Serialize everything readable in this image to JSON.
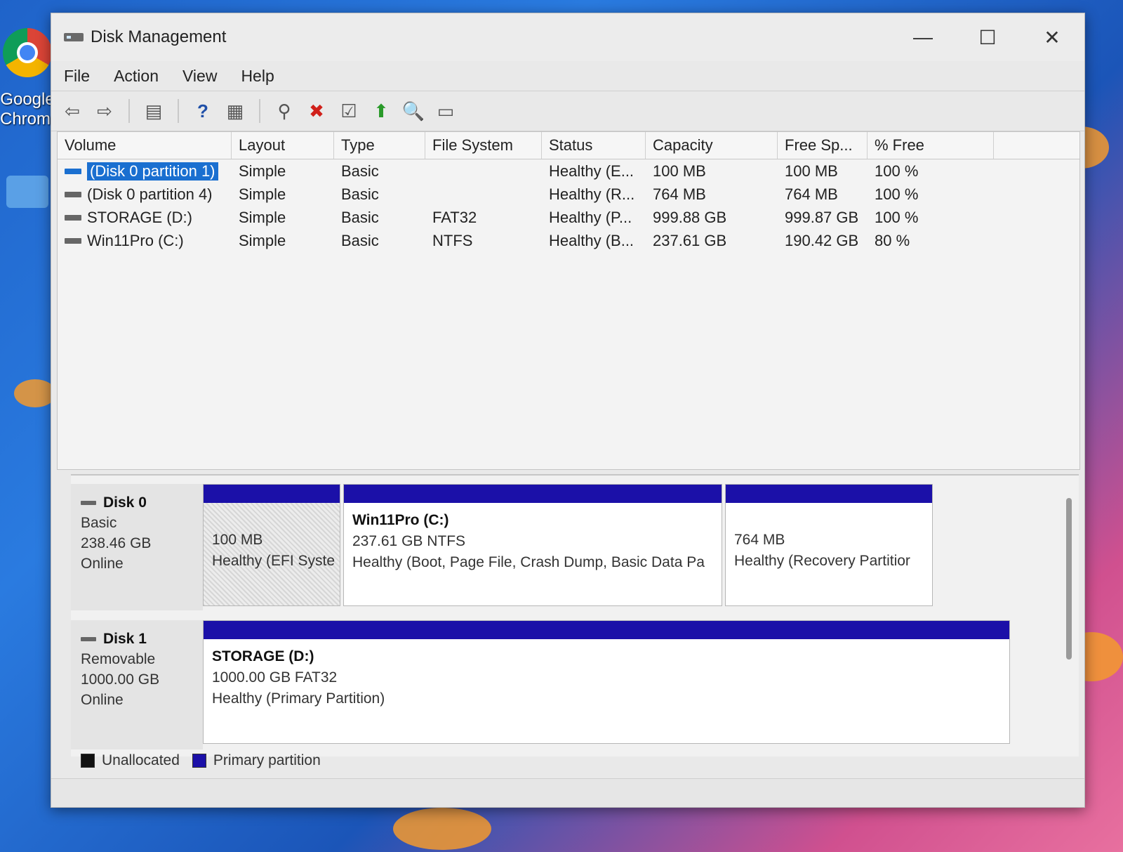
{
  "desktop": {
    "chrome_label_line1": "Google",
    "chrome_label_line2": "Chrome"
  },
  "window": {
    "title": "Disk Management",
    "minimize": "—",
    "maximize": "☐",
    "close": "✕"
  },
  "menu": [
    "File",
    "Action",
    "View",
    "Help"
  ],
  "toolbar": {
    "back": "⇦",
    "forward": "⇨",
    "console": "▤",
    "help": "?",
    "properties": "▦",
    "connect": "⚲",
    "delete": "✖",
    "check": "☑",
    "new": "⬆",
    "search": "🔍",
    "view": "▭"
  },
  "columns": [
    "Volume",
    "Layout",
    "Type",
    "File System",
    "Status",
    "Capacity",
    "Free Sp...",
    "% Free"
  ],
  "volumes": [
    {
      "volume": "(Disk 0 partition 1)",
      "layout": "Simple",
      "type": "Basic",
      "fs": "",
      "status": "Healthy (E...",
      "capacity": "100 MB",
      "free": "100 MB",
      "pct": "100 %"
    },
    {
      "volume": "(Disk 0 partition 4)",
      "layout": "Simple",
      "type": "Basic",
      "fs": "",
      "status": "Healthy (R...",
      "capacity": "764 MB",
      "free": "764 MB",
      "pct": "100 %"
    },
    {
      "volume": "STORAGE (D:)",
      "layout": "Simple",
      "type": "Basic",
      "fs": "FAT32",
      "status": "Healthy (P...",
      "capacity": "999.88 GB",
      "free": "999.87 GB",
      "pct": "100 %"
    },
    {
      "volume": "Win11Pro (C:)",
      "layout": "Simple",
      "type": "Basic",
      "fs": "NTFS",
      "status": "Healthy (B...",
      "capacity": "237.61 GB",
      "free": "190.42 GB",
      "pct": "80 %"
    }
  ],
  "disks": [
    {
      "name": "Disk 0",
      "type": "Basic",
      "size": "238.46 GB",
      "state": "Online",
      "partitions": [
        {
          "title": "",
          "line1": "100 MB",
          "line2": "Healthy (EFI Syste"
        },
        {
          "title": "Win11Pro  (C:)",
          "line1": "237.61 GB NTFS",
          "line2": "Healthy (Boot, Page File, Crash Dump, Basic Data Pa"
        },
        {
          "title": "",
          "line1": "764 MB",
          "line2": "Healthy (Recovery Partitior"
        }
      ]
    },
    {
      "name": "Disk 1",
      "type": "Removable",
      "size": "1000.00 GB",
      "state": "Online",
      "partitions": [
        {
          "title": "STORAGE  (D:)",
          "line1": "1000.00 GB FAT32",
          "line2": "Healthy (Primary Partition)"
        }
      ]
    }
  ],
  "legend": {
    "unallocated": "Unallocated",
    "primary": "Primary partition"
  },
  "colors": {
    "primary_bar": "#1b10a8",
    "selection": "#1a6fd0",
    "unallocated": "#111111"
  }
}
